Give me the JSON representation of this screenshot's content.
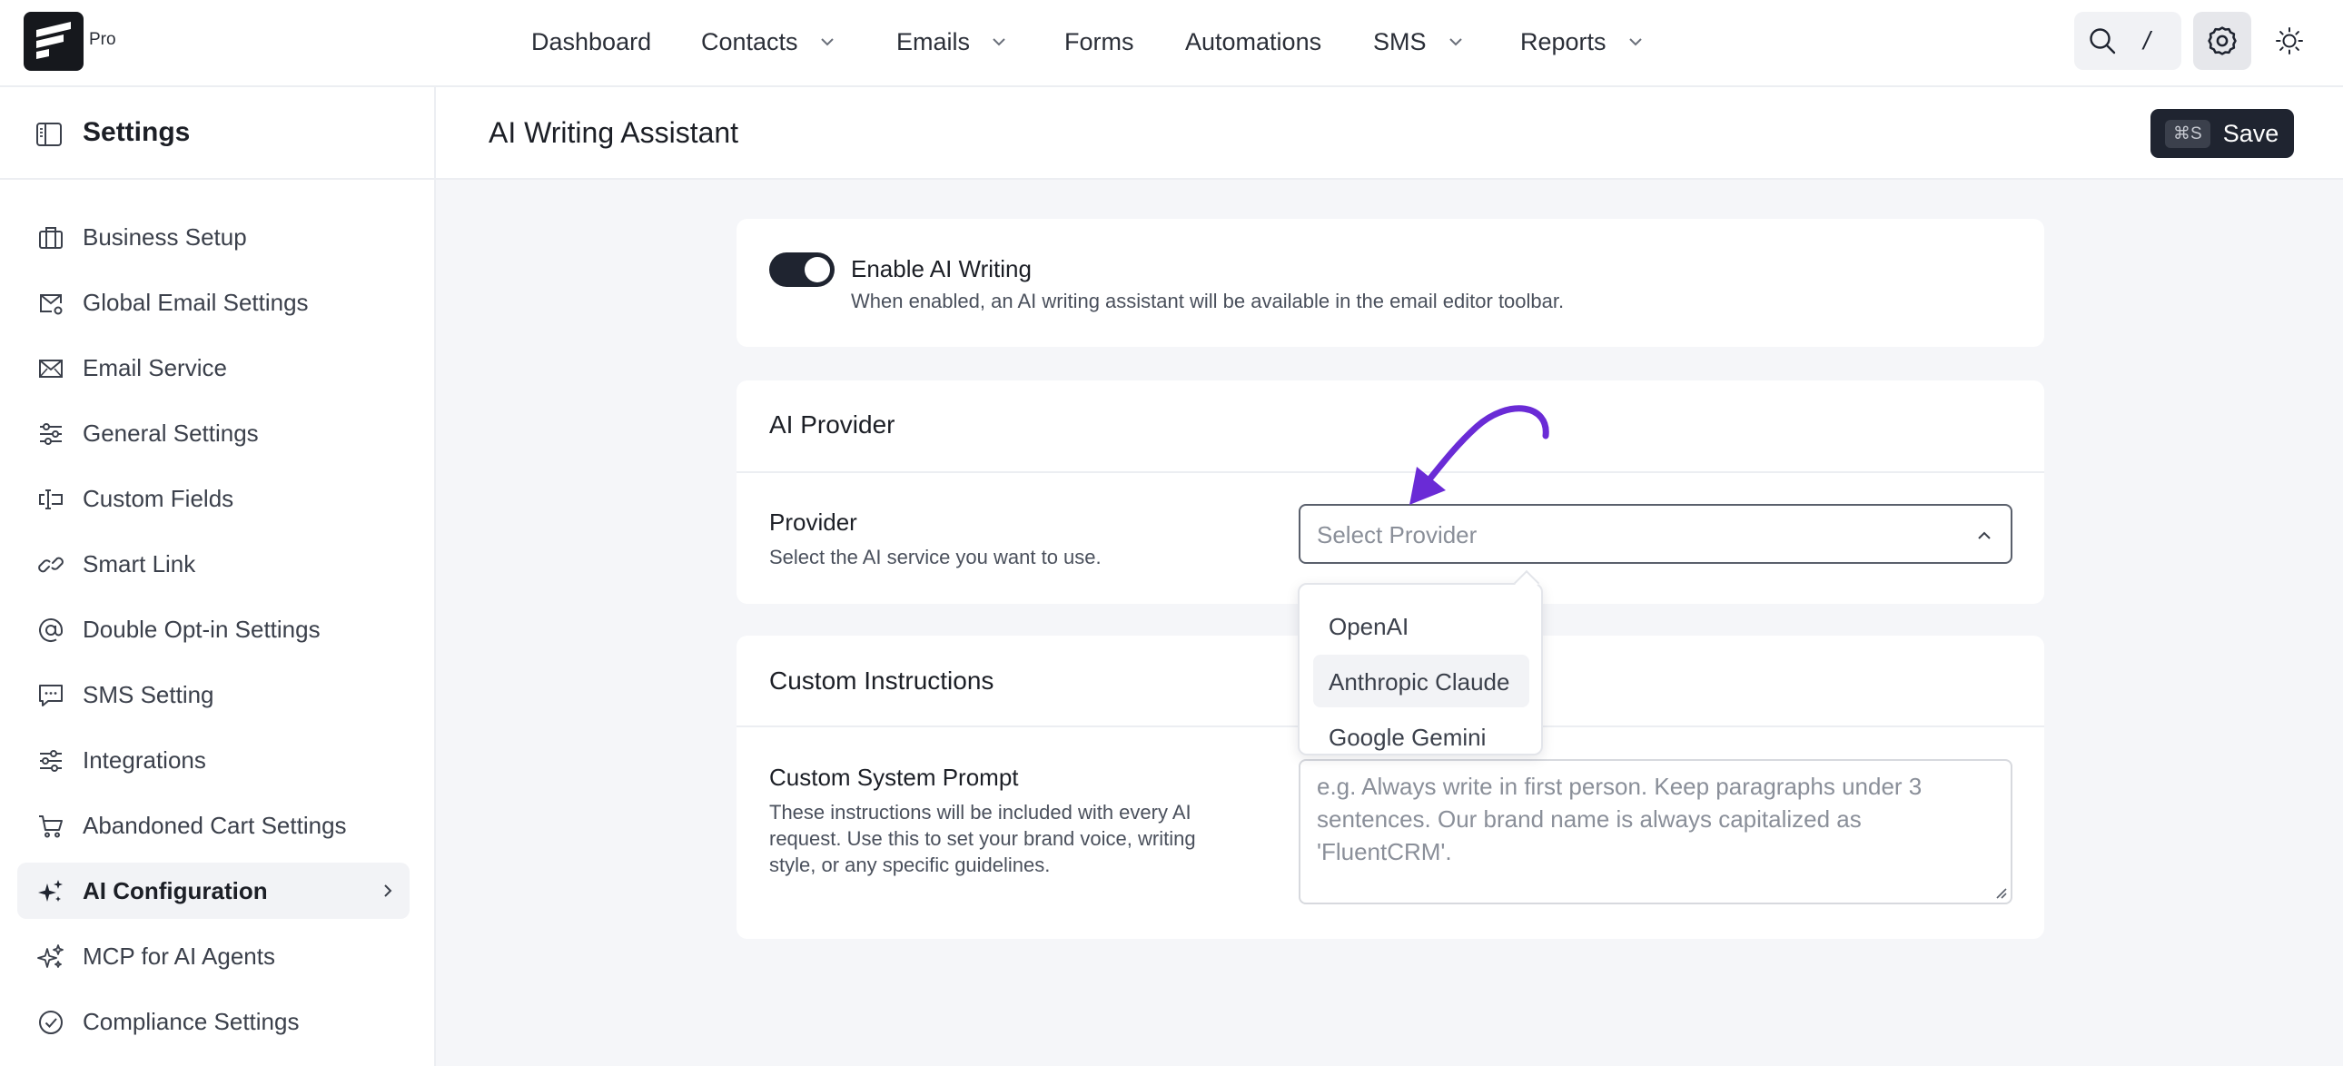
{
  "brand": {
    "badge": "Pro"
  },
  "nav": {
    "items": [
      {
        "label": "Dashboard",
        "has_dropdown": false
      },
      {
        "label": "Contacts",
        "has_dropdown": true
      },
      {
        "label": "Emails",
        "has_dropdown": true
      },
      {
        "label": "Forms",
        "has_dropdown": false
      },
      {
        "label": "Automations",
        "has_dropdown": false
      },
      {
        "label": "SMS",
        "has_dropdown": true
      },
      {
        "label": "Reports",
        "has_dropdown": true
      }
    ],
    "search_shortcut": "/",
    "icons": [
      "search-icon",
      "gear-icon",
      "sun-icon"
    ]
  },
  "sidebar": {
    "title": "Settings",
    "items": [
      {
        "label": "Business Setup",
        "icon": "briefcase-icon"
      },
      {
        "label": "Global Email Settings",
        "icon": "mail-settings-icon"
      },
      {
        "label": "Email Service",
        "icon": "mail-send-icon"
      },
      {
        "label": "General Settings",
        "icon": "sliders-icon"
      },
      {
        "label": "Custom Fields",
        "icon": "text-field-icon"
      },
      {
        "label": "Smart Link",
        "icon": "link-icon"
      },
      {
        "label": "Double Opt-in Settings",
        "icon": "at-sign-icon"
      },
      {
        "label": "SMS Setting",
        "icon": "message-icon"
      },
      {
        "label": "Integrations",
        "icon": "sliders-icon"
      },
      {
        "label": "Abandoned Cart Settings",
        "icon": "cart-icon"
      },
      {
        "label": "AI Configuration",
        "icon": "sparkles-icon",
        "active": true
      },
      {
        "label": "MCP for AI Agents",
        "icon": "sparkles-icon"
      },
      {
        "label": "Compliance Settings",
        "icon": "check-circle-icon"
      }
    ]
  },
  "header": {
    "title": "AI Writing Assistant",
    "save_shortcut": "⌘S",
    "save_label": "Save"
  },
  "enable_card": {
    "toggle_on": true,
    "title": "Enable AI Writing",
    "description": "When enabled, an AI writing assistant will be available in the email editor toolbar."
  },
  "provider_card": {
    "section_title": "AI Provider",
    "label": "Provider",
    "description": "Select the AI service you want to use.",
    "placeholder": "Select Provider",
    "options": [
      "OpenAI",
      "Anthropic Claude",
      "Google Gemini"
    ],
    "hovered_option": "Anthropic Claude"
  },
  "instructions_card": {
    "section_title": "Custom Instructions",
    "label": "Custom System Prompt",
    "description_lines": [
      "These instructions will be included with every AI",
      "request. Use this to set your brand voice, writing",
      "style, or any specific guidelines."
    ],
    "placeholder_lines": [
      "e.g. Always write in first person. Keep paragraphs under 3",
      "sentences. Our brand name is always capitalized as",
      "'FluentCRM'."
    ]
  },
  "colors": {
    "accent_dark": "#1f2430",
    "annotation_arrow": "#6a2bd6",
    "page_background": "#f5f6f9"
  }
}
